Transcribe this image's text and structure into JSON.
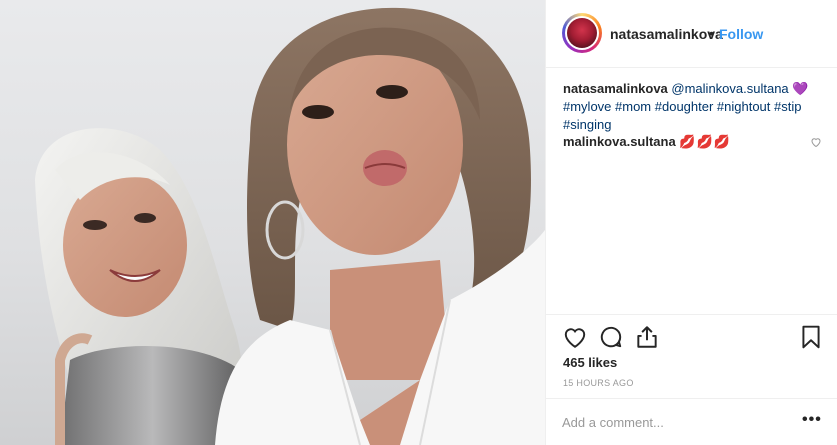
{
  "header": {
    "username": "natasamalinkova",
    "separator": "•",
    "follow_label": "Follow"
  },
  "caption": {
    "username": "natasamalinkova",
    "mention": "@malinkova.sultana",
    "emoji": "💜",
    "hashtags_line1": "#mylove #mom #doughter #nightout #stip",
    "hashtags_line2": "#singing"
  },
  "comment": {
    "username": "malinkova.sultana",
    "text": "💋💋💋"
  },
  "actions": {
    "like_icon": "heart-outline-icon",
    "comment_icon": "speech-bubble-icon",
    "share_icon": "share-icon",
    "save_icon": "bookmark-icon"
  },
  "likes": "465 likes",
  "timestamp": "15 HOURS AGO",
  "add_comment": {
    "placeholder": "Add a comment...",
    "more": "•••"
  },
  "colors": {
    "link_blue": "#3897f0",
    "hashtag": "#003569",
    "border": "#efefef",
    "muted": "#999999"
  }
}
